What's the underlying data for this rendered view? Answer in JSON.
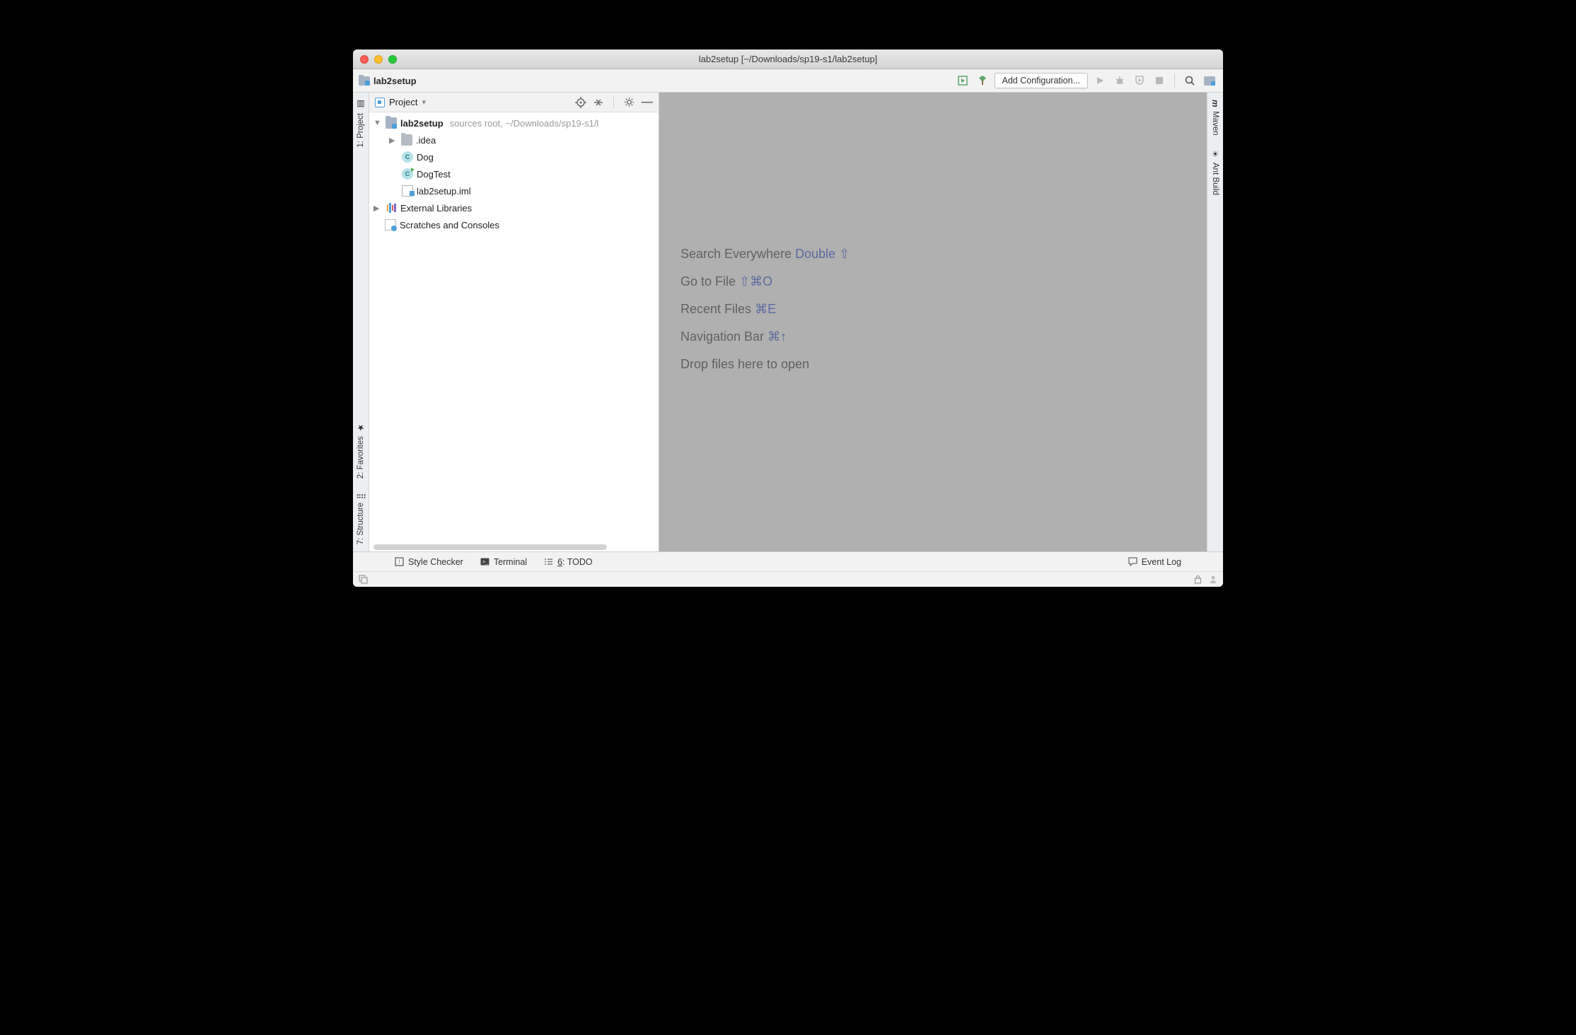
{
  "window": {
    "title": "lab2setup [~/Downloads/sp19-s1/lab2setup]"
  },
  "breadcrumb": {
    "project": "lab2setup"
  },
  "toolbar": {
    "config_label": "Add Configuration..."
  },
  "side": {
    "tab": "Project",
    "root": {
      "name": "lab2setup",
      "meta": "sources root,  ~/Downloads/sp19-s1/l"
    },
    "children": [
      {
        "name": ".idea",
        "kind": "folder"
      },
      {
        "name": "Dog",
        "kind": "class"
      },
      {
        "name": "DogTest",
        "kind": "class-run"
      },
      {
        "name": "lab2setup.iml",
        "kind": "iml"
      }
    ],
    "ext_libs": "External Libraries",
    "scratches": "Scratches and Consoles"
  },
  "hints": [
    {
      "text": "Search Everywhere",
      "shortcut": "Double ⇧"
    },
    {
      "text": "Go to File",
      "shortcut": "⇧⌘O"
    },
    {
      "text": "Recent Files",
      "shortcut": "⌘E"
    },
    {
      "text": "Navigation Bar",
      "shortcut": "⌘↑"
    },
    {
      "text": "Drop files here to open",
      "shortcut": ""
    }
  ],
  "left_gutter": [
    {
      "label": "1: Project"
    },
    {
      "label": "2: Favorites"
    },
    {
      "label": "7: Structure"
    }
  ],
  "right_gutter": [
    {
      "label": "Maven"
    },
    {
      "label": "Ant Build"
    }
  ],
  "bottom": {
    "style": "Style Checker",
    "terminal": "Terminal",
    "todo_prefix": "6",
    "todo": ": TODO",
    "event_log": "Event Log"
  }
}
